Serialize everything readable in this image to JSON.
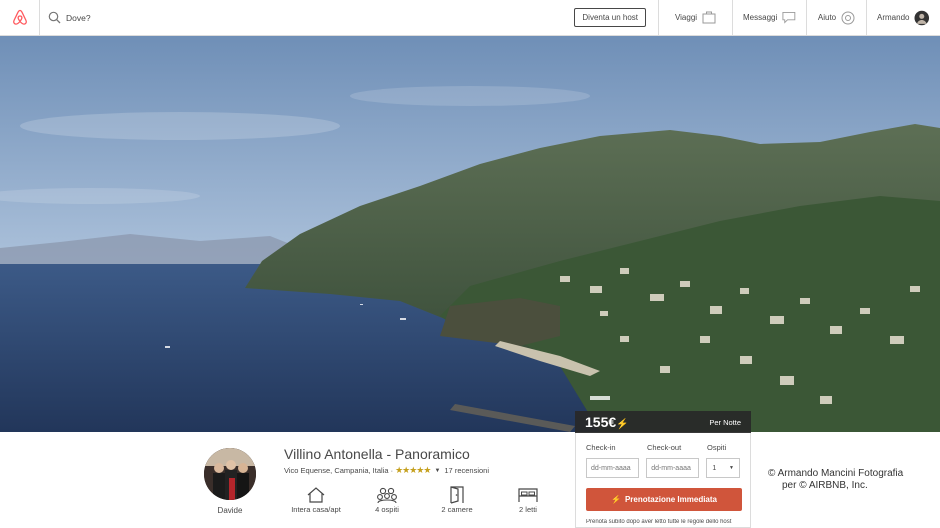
{
  "nav": {
    "search_placeholder": "Dove?",
    "host_button": "Diventa un host",
    "trips": "Viaggi",
    "messages": "Messaggi",
    "help": "Aiuto",
    "user": "Armando",
    "brand_color": "#ff5a5f"
  },
  "listing": {
    "price": "155€",
    "per_night": "Per Notte",
    "title": "Villino Antonella - Panoramico",
    "location": "Vico Equense, Campania, Italia ·",
    "stars": "★★★★★",
    "reviews": "17 recensioni",
    "host_name": "Davide",
    "features": [
      {
        "icon": "house-icon",
        "label": "Intera casa/apt"
      },
      {
        "icon": "guests-icon",
        "label": "4 ospiti"
      },
      {
        "icon": "door-icon",
        "label": "2 camere"
      },
      {
        "icon": "bed-icon",
        "label": "2 letti"
      }
    ]
  },
  "booking": {
    "checkin_label": "Check-in",
    "checkout_label": "Check-out",
    "guests_label": "Ospiti",
    "checkin_placeholder": "dd-mm-aaaa",
    "checkout_placeholder": "dd-mm-aaaa",
    "guests_value": "1",
    "cta": "Prenotazione Immediata",
    "cta_color": "#d0553b",
    "fine_print": "Prenota subito dopo aver letto tutte le regole dello host"
  },
  "credit": {
    "line1": "© Armando Mancini Fotografia",
    "line2": "per © AIRBNB, Inc."
  }
}
